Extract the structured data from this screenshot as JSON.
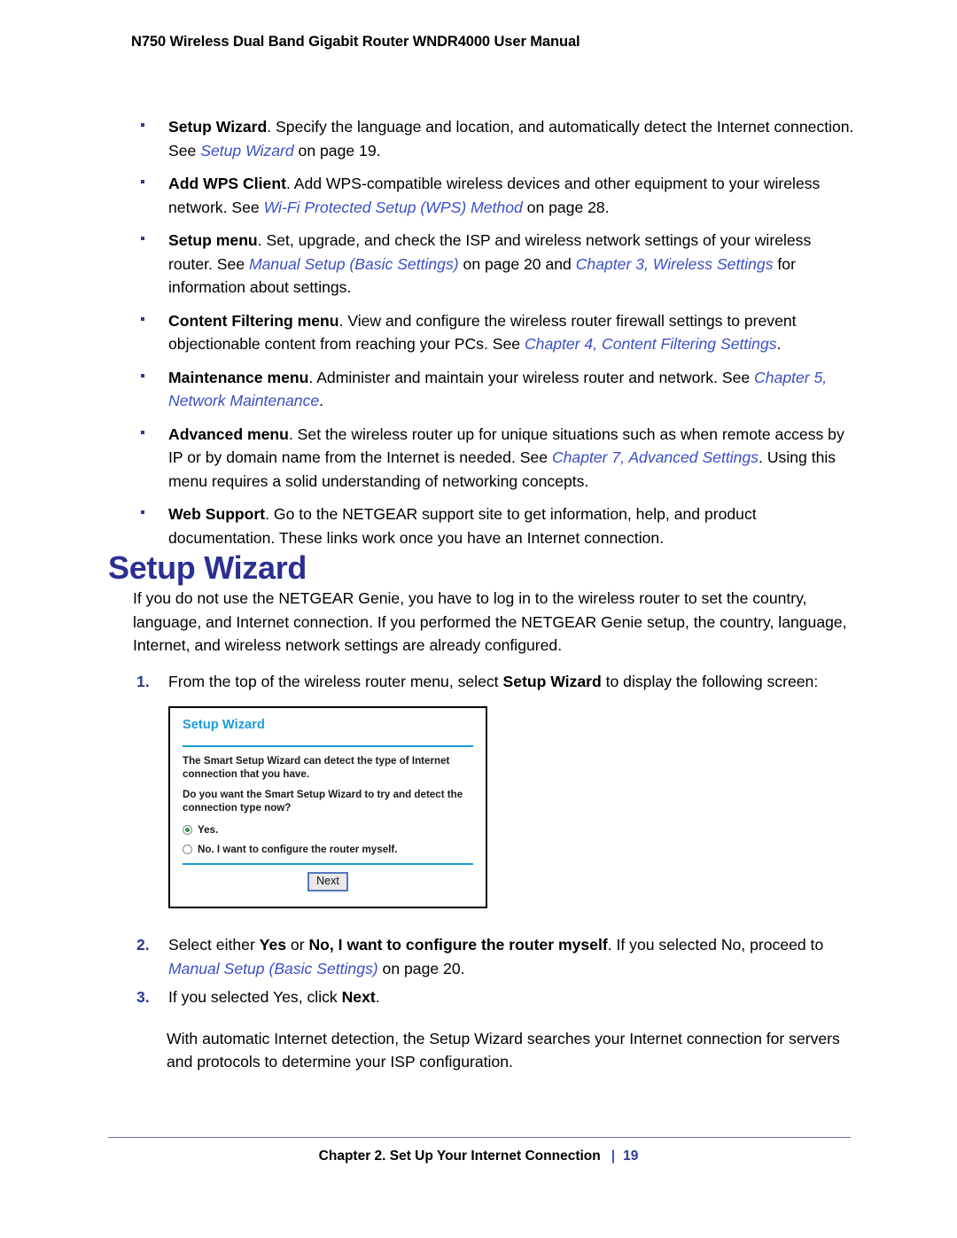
{
  "header": {
    "running_title": "N750 Wireless Dual Band Gigabit Router WNDR4000 User Manual"
  },
  "bullets": [
    {
      "lead": "Setup Wizard",
      "text_1": ". Specify the language and location, and automatically detect the Internet connection. See ",
      "xref_1": "Setup Wizard",
      "text_2": " on page 19."
    },
    {
      "lead": "Add WPS Client",
      "text_1": ". Add WPS-compatible wireless devices and other equipment to your wireless network. See ",
      "xref_1": "Wi-Fi Protected Setup (WPS) Method",
      "text_2": " on page 28."
    },
    {
      "lead": "Setup menu",
      "text_1": ". Set, upgrade, and check the ISP and wireless network settings of your wireless router. See ",
      "xref_1": "Manual Setup (Basic Settings)",
      "text_2": " on page 20 and ",
      "xref_2": "Chapter 3, Wireless Settings",
      "text_3": " for information about settings."
    },
    {
      "lead": "Content Filtering menu",
      "text_1": ". View and configure the wireless router firewall settings to prevent objectionable content from reaching your PCs. See ",
      "xref_1": "Chapter 4, Content Filtering Settings",
      "text_2": "."
    },
    {
      "lead": "Maintenance menu",
      "text_1": ". Administer and maintain your wireless router and network. See ",
      "xref_1": "Chapter 5, Network Maintenance",
      "text_2": "."
    },
    {
      "lead": "Advanced menu",
      "text_1": ". Set the wireless router up for unique situations such as when remote access by IP or by domain name from the Internet is needed. See ",
      "xref_1": "Chapter 7, Advanced Settings",
      "text_2": ". Using this menu requires a solid understanding of networking concepts."
    },
    {
      "lead": "Web Support",
      "text_1": ". Go to the NETGEAR support site to get information, help, and product documentation. These links work once you have an Internet connection.",
      "xref_1": "",
      "text_2": ""
    }
  ],
  "section": {
    "heading": "Setup Wizard",
    "intro": "If you do not use the NETGEAR Genie, you have to log in to the wireless router to set the country, language, and Internet connection. If you performed the NETGEAR Genie setup, the country, language, Internet, and wireless network settings are already configured."
  },
  "steps": [
    {
      "number": "1.",
      "text_1": "From the top of the wireless router menu, select ",
      "bold_1": "Setup Wizard",
      "text_2": " to display the following screen:"
    },
    {
      "number": "2.",
      "text_1": "Select either ",
      "bold_1": "Yes",
      "text_2": " or ",
      "bold_2": "No, I want to configure the router myself",
      "text_3": ". If you selected No, proceed to ",
      "xref_1": "Manual Setup (Basic Settings)",
      "text_4": " on page 20."
    },
    {
      "number": "3.",
      "text_1": "If you selected Yes, click ",
      "bold_1": "Next",
      "text_2": "."
    }
  ],
  "figure": {
    "title": "Setup Wizard",
    "paragraph_1": "The Smart Setup Wizard can detect the type of Internet connection that you have.",
    "paragraph_2": "Do you want the Smart Setup Wizard to try and detect the connection type now?",
    "options": [
      {
        "label": "Yes.",
        "selected": true
      },
      {
        "label": "No. I want to configure the router myself.",
        "selected": false
      }
    ],
    "next_button": "Next",
    "accent_color": "#1b9bd8",
    "radio_selected_color": "#2e9b3f"
  },
  "closing": {
    "text": "With automatic Internet detection, the Setup Wizard searches your Internet connection for servers and protocols to determine your ISP configuration."
  },
  "footer": {
    "chapter": "Chapter 2.  Set Up Your Internet Connection",
    "separator": "|",
    "page_number": "19"
  }
}
